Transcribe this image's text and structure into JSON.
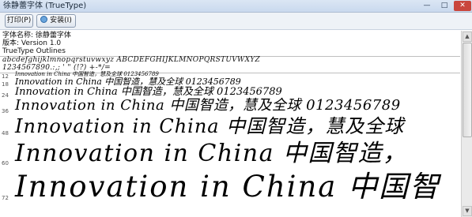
{
  "window": {
    "title": "徐静蕾字体 (TrueType)",
    "controls": [
      "—",
      "□",
      "✕"
    ]
  },
  "toolbar": {
    "print_label": "打印(P)",
    "install_label": "安装(I)"
  },
  "font_info": {
    "name_line": "字体名称: 徐静蕾字体",
    "version_line": "版本: Version 1.0",
    "type_line": "TrueType Outlines"
  },
  "charset": {
    "line1": "abcdefghijklmnopqrstuvwxyz ABCDEFGHIJKLMNOPQRSTUVWXYZ",
    "line2": "1234567890.:,; ' \" (!?) +-*/="
  },
  "samples": [
    {
      "size": "12",
      "text": "Innovation in China 中国智造，慧及全球 0123456789"
    },
    {
      "size": "18",
      "text": "Innovation in China 中国智造，慧及全球 0123456789"
    },
    {
      "size": "24",
      "text": "Innovation in China 中国智造，慧及全球 0123456789"
    },
    {
      "size": "36",
      "text": "Innovation in China 中国智造，慧及全球 0123456789"
    },
    {
      "size": "48",
      "text": "Innovation in China 中国智造，慧及全球"
    },
    {
      "size": "60",
      "text": "Innovation in China 中国智造，"
    },
    {
      "size": "72",
      "text": "Innovation in China 中国智"
    }
  ]
}
